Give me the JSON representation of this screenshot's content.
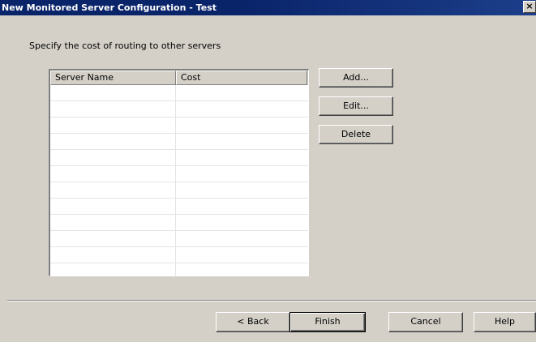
{
  "window": {
    "title": "New Monitored Server Configuration - Test",
    "close_glyph": "×"
  },
  "instruction": "Specify the cost of routing to other servers",
  "table": {
    "columns": [
      "Server Name",
      "Cost"
    ],
    "rows": [
      [
        "",
        ""
      ],
      [
        "",
        ""
      ],
      [
        "",
        ""
      ],
      [
        "",
        ""
      ],
      [
        "",
        ""
      ],
      [
        "",
        ""
      ],
      [
        "",
        ""
      ],
      [
        "",
        ""
      ],
      [
        "",
        ""
      ],
      [
        "",
        ""
      ],
      [
        "",
        ""
      ],
      [
        "",
        ""
      ]
    ]
  },
  "side_buttons": {
    "add": "Add...",
    "edit": "Edit...",
    "delete": "Delete"
  },
  "footer_buttons": {
    "back": "< Back",
    "finish": "Finish",
    "cancel": "Cancel",
    "help": "Help"
  }
}
